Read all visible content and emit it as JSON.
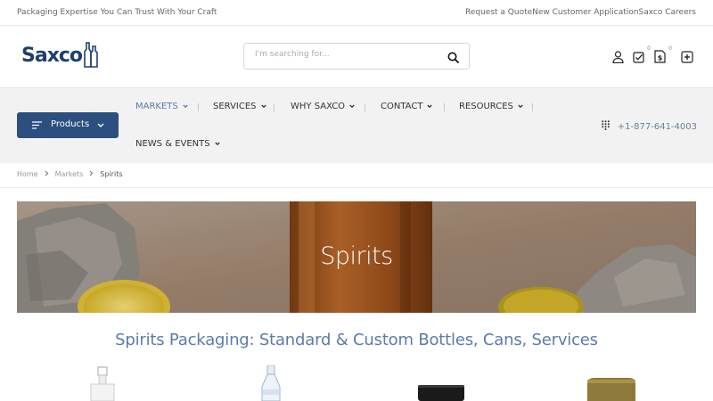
{
  "topbar": {
    "tagline": "Packaging Expertise You Can Trust With Your Craft",
    "links": [
      "Request a Quote",
      "New Customer Application",
      "Saxco Careers"
    ]
  },
  "header": {
    "logo_text": "Saxco",
    "search_placeholder": "I'm searching for...",
    "cart_count": "0",
    "quote_count": "0"
  },
  "nav": {
    "products_label": "Products",
    "items": [
      "MARKETS",
      "SERVICES",
      "WHY SAXCO",
      "CONTACT",
      "RESOURCES",
      "NEWS & EVENTS"
    ],
    "active": "MARKETS",
    "phone": "+1-877-641-4003"
  },
  "breadcrumb": [
    "Home",
    "Markets",
    "Spirits"
  ],
  "hero": {
    "title": "Spirits"
  },
  "main": {
    "heading": "Spirits Packaging: Standard & Custom Bottles, Cans, Services"
  },
  "colors": {
    "brand": "#1f3f6e",
    "button": "#2c4f80",
    "accent": "#5b7bab",
    "nav_bg": "#f2f2f2"
  }
}
